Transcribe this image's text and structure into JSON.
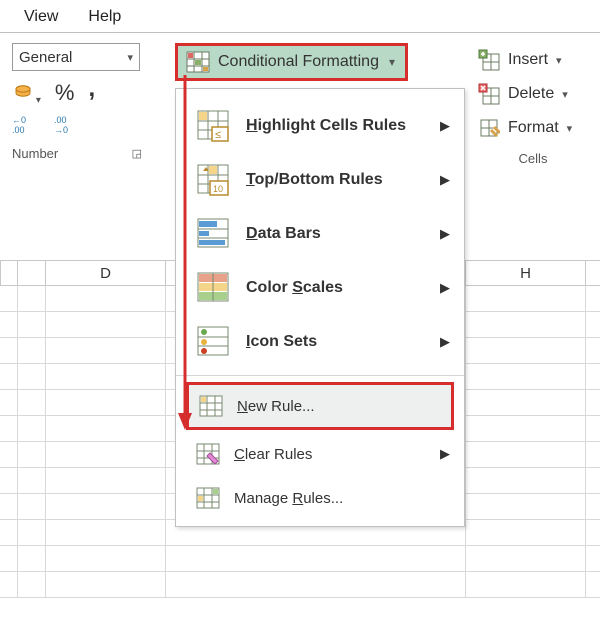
{
  "menubar": {
    "view": "View",
    "help": "Help"
  },
  "number_group": {
    "selector_value": "General",
    "label": "Number"
  },
  "cf_button": {
    "label": "Conditional Formatting"
  },
  "cells_group": {
    "insert": "Insert",
    "delete": "Delete",
    "format": "Format",
    "label": "Cells"
  },
  "dropdown": {
    "highlight": "Highlight Cells Rules",
    "topbottom": "Top/Bottom Rules",
    "databars": "Data Bars",
    "colorscales": "Color Scales",
    "iconsets": "Icon Sets",
    "newrule": "New Rule...",
    "clearrules": "Clear Rules",
    "managerules": "Manage Rules..."
  },
  "columns": {
    "d": "D",
    "h": "H"
  }
}
